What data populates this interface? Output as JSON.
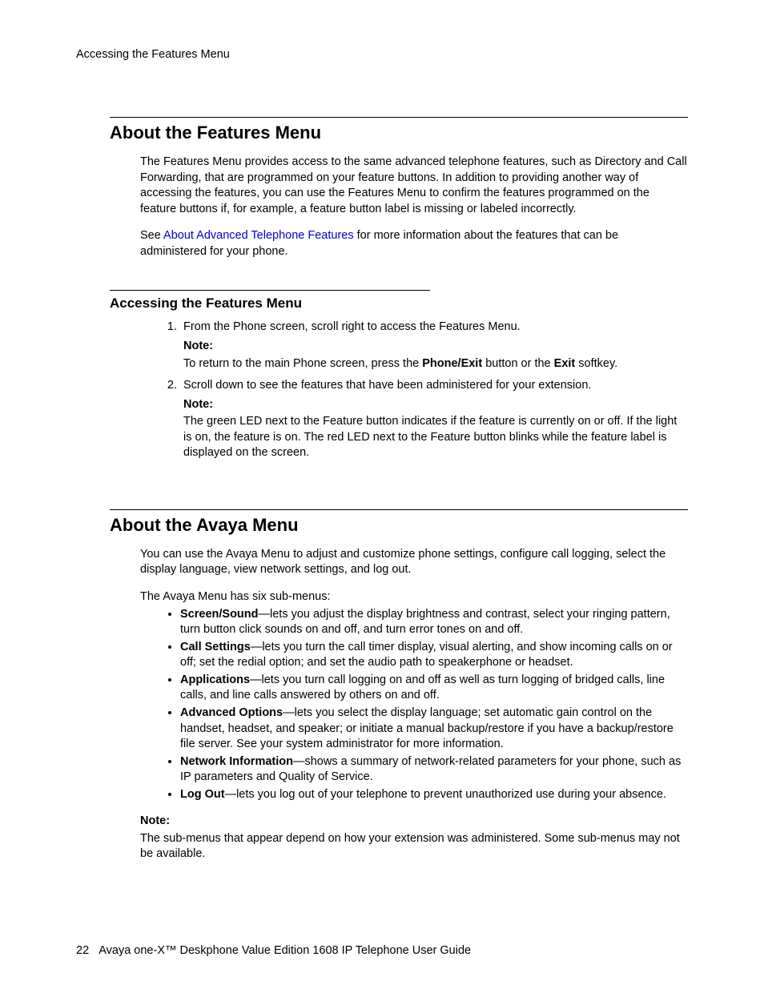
{
  "header": {
    "running": "Accessing the Features Menu"
  },
  "section1": {
    "title": "About the Features Menu",
    "p1": "The Features Menu provides access to the same advanced telephone features, such as Directory and Call Forwarding, that are programmed on your feature buttons. In addition to providing another way of accessing the features, you can use the Features Menu to confirm the features programmed on the feature buttons if, for example, a feature button label is missing or labeled incorrectly.",
    "p2_pre": "See ",
    "p2_link": "About Advanced Telephone Features",
    "p2_post": " for more information about the features that can be administered for your phone.",
    "sub": {
      "title": "Accessing the Features Menu",
      "step1": "From the Phone screen, scroll right to access the Features Menu.",
      "note_lbl": "Note:",
      "step1_note_pre": "To return to the main Phone screen, press the ",
      "step1_note_b1": "Phone/Exit",
      "step1_note_mid": " button or the ",
      "step1_note_b2": "Exit",
      "step1_note_post": " softkey.",
      "step2": "Scroll down to see the features that have been administered for your extension.",
      "step2_note": "The green LED next to the Feature button indicates if the feature is currently on or off. If the light is on, the feature is on. The red LED next to the Feature button blinks while the feature label is displayed on the screen."
    }
  },
  "section2": {
    "title": "About the Avaya Menu",
    "p1": "You can use the Avaya Menu to adjust and customize phone settings, configure call logging, select the display language, view network settings, and log out.",
    "p2": "The Avaya Menu has six sub-menus:",
    "items": [
      {
        "name": "Screen/Sound",
        "desc": "—lets you adjust the display brightness and contrast, select your ringing pattern, turn button click sounds on and off, and turn error tones on and off."
      },
      {
        "name": "Call Settings",
        "desc": "—lets you turn the call timer display, visual alerting, and show incoming calls on or off; set the redial option; and set the audio path to speakerphone or headset."
      },
      {
        "name": "Applications",
        "desc": "—lets you turn call logging on and off as well as turn logging of bridged calls, line calls, and line calls answered by others on and off."
      },
      {
        "name": "Advanced Options",
        "desc": "—lets you select the display language; set automatic gain control on the handset, headset, and speaker; or initiate a manual backup/restore if you have a backup/restore file server. See your system administrator for more information."
      },
      {
        "name": "Network Information",
        "desc": "—shows a summary of network-related parameters for your phone, such as IP parameters and Quality of Service."
      },
      {
        "name": "Log Out",
        "desc": "—lets you log out of your telephone to prevent unauthorized use during your absence."
      }
    ],
    "note_lbl": "Note:",
    "note": "The sub-menus that appear depend on how your extension was administered. Some sub-menus may not be available."
  },
  "footer": {
    "page": "22",
    "title": "Avaya one-X™ Deskphone Value Edition 1608 IP Telephone User Guide"
  }
}
